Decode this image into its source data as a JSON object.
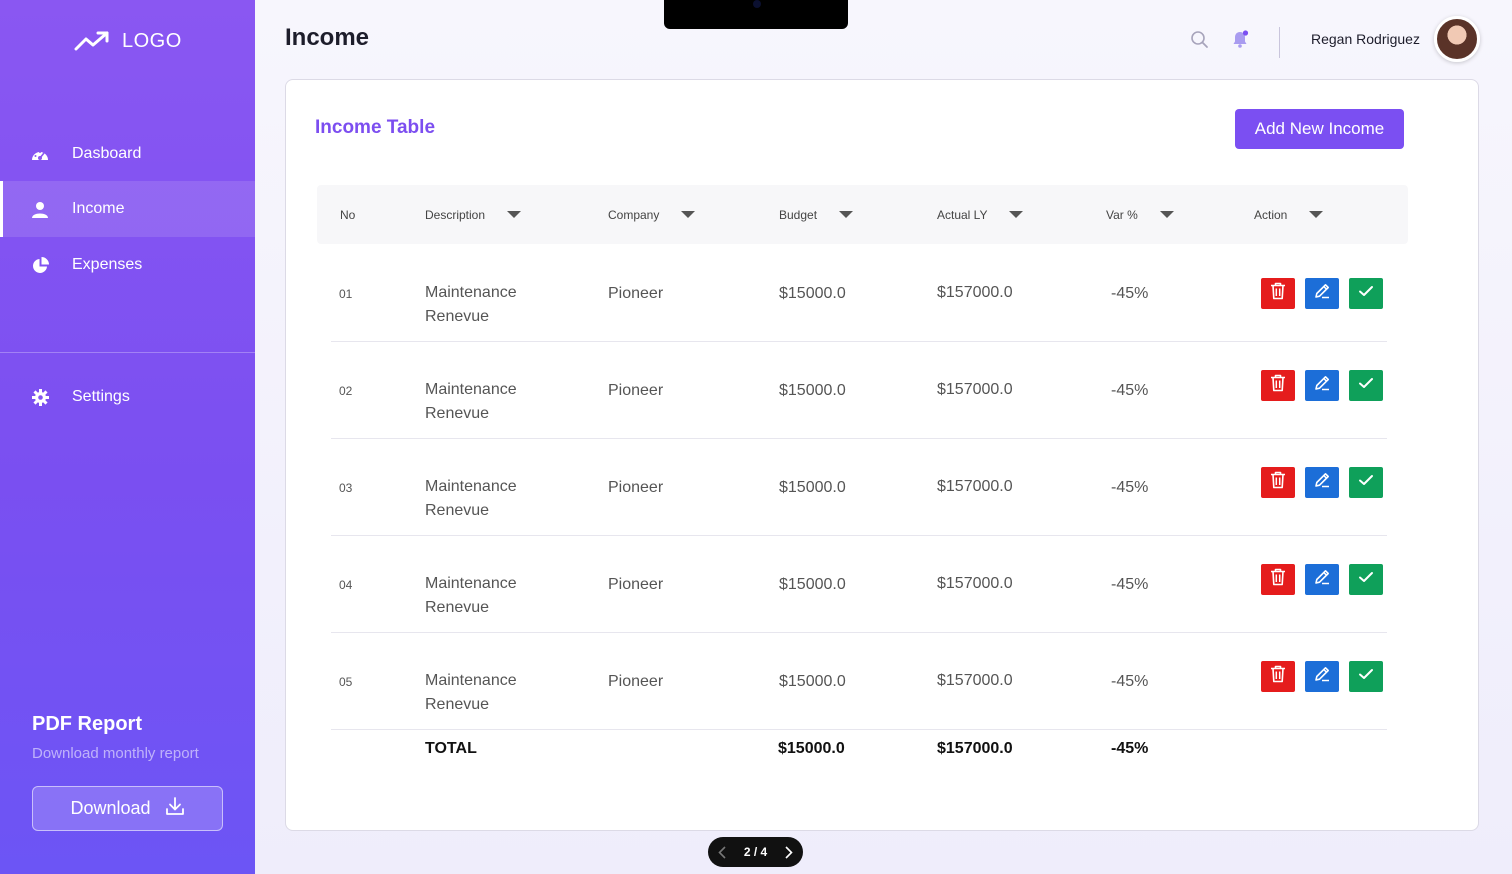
{
  "sidebar": {
    "logo_text": "LOGO",
    "items": [
      {
        "label": "Dasboard",
        "icon": "dashboard-icon"
      },
      {
        "label": "Income",
        "icon": "user-icon"
      },
      {
        "label": "Expenses",
        "icon": "pie-chart-icon"
      },
      {
        "label": "Settings",
        "icon": "gear-icon"
      }
    ],
    "active_item": "Income",
    "pdf_report": {
      "title": "PDF Report",
      "subtitle": "Download monthly report",
      "button_label": "Download"
    }
  },
  "header": {
    "title": "Income",
    "user_name": "Regan Rodriguez"
  },
  "table_card": {
    "title": "Income Table",
    "add_button_label": "Add New Income",
    "columns": [
      "No",
      "Description",
      "Company",
      "Budget",
      "Actual LY",
      "Var %",
      "Action"
    ],
    "rows": [
      {
        "no": "01",
        "desc1": "Maintenance",
        "desc2": "Renevue",
        "company": "Pioneer",
        "budget": "$15000.0",
        "actual": "$157000.0",
        "var": "-45%"
      },
      {
        "no": "02",
        "desc1": "Maintenance",
        "desc2": "Renevue",
        "company": "Pioneer",
        "budget": "$15000.0",
        "actual": "$157000.0",
        "var": "-45%"
      },
      {
        "no": "03",
        "desc1": "Maintenance",
        "desc2": "Renevue",
        "company": "Pioneer",
        "budget": "$15000.0",
        "actual": "$157000.0",
        "var": "-45%"
      },
      {
        "no": "04",
        "desc1": "Maintenance",
        "desc2": "Renevue",
        "company": "Pioneer",
        "budget": "$15000.0",
        "actual": "$157000.0",
        "var": "-45%"
      },
      {
        "no": "05",
        "desc1": "Maintenance",
        "desc2": "Renevue",
        "company": "Pioneer",
        "budget": "$15000.0",
        "actual": "$157000.0",
        "var": "-45%"
      }
    ],
    "total": {
      "label": "TOTAL",
      "budget": "$15000.0",
      "actual": "$157000.0",
      "var": "-45%"
    }
  },
  "pager": {
    "text": "2 / 4"
  },
  "colors": {
    "accent": "#7b4ff2",
    "delete": "#e51c1c",
    "edit": "#1c6ed8",
    "approve": "#0fa05a"
  }
}
